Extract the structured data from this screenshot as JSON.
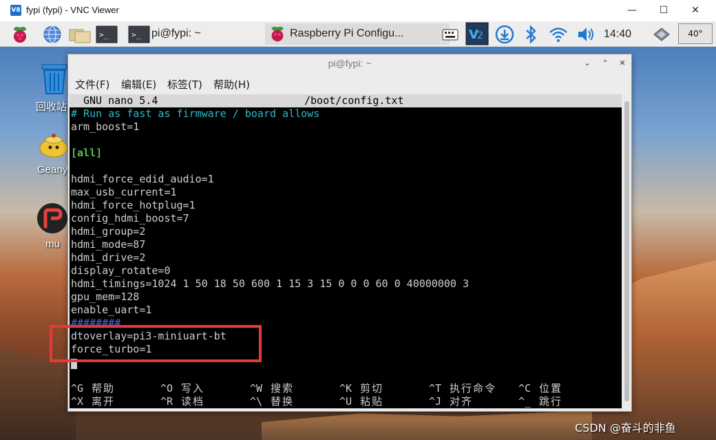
{
  "vnc": {
    "icon_text": "V8",
    "title": "fypi (fypi) - VNC Viewer",
    "minimize": "—",
    "maximize": "☐",
    "close": "✕"
  },
  "taskbar": {
    "tasks": [
      {
        "label": "pi@fypi: ~",
        "icon": "terminal-icon"
      },
      {
        "label": "Raspberry Pi Configu...",
        "icon": "raspberry-icon"
      }
    ],
    "clock": "14:40",
    "cpu_temp": "40°"
  },
  "desktop": {
    "icons": [
      {
        "label": "回收站",
        "icon": "trash-icon"
      },
      {
        "label": "Geany",
        "icon": "geany-icon"
      },
      {
        "label": "mu",
        "icon": "mu-editor-icon"
      }
    ]
  },
  "terminal": {
    "title": "pi@fypi: ~",
    "menu": [
      "文件(F)",
      "编辑(E)",
      "标签(T)",
      "帮助(H)"
    ],
    "header_app": "GNU nano 5.4",
    "header_file": "/boot/config.txt",
    "lines": [
      {
        "text": "# Run as fast as firmware / board allows",
        "style": "cyan"
      },
      {
        "text": "arm_boost=1",
        "style": "plain"
      },
      {
        "text": "",
        "style": "plain"
      },
      {
        "text": "[all]",
        "style": "green"
      },
      {
        "text": "",
        "style": "plain"
      },
      {
        "text": "hdmi_force_edid_audio=1",
        "style": "plain"
      },
      {
        "text": "max_usb_current=1",
        "style": "plain"
      },
      {
        "text": "hdmi_force_hotplug=1",
        "style": "plain"
      },
      {
        "text": "config_hdmi_boost=7",
        "style": "plain"
      },
      {
        "text": "hdmi_group=2",
        "style": "plain"
      },
      {
        "text": "hdmi_mode=87",
        "style": "plain"
      },
      {
        "text": "hdmi_drive=2",
        "style": "plain"
      },
      {
        "text": "display_rotate=0",
        "style": "plain"
      },
      {
        "text": "hdmi_timings=1024 1 50 18 50 600 1 15 3 15 0 0 0 60 0 40000000 3",
        "style": "plain"
      },
      {
        "text": "gpu_mem=128",
        "style": "plain"
      },
      {
        "text": "enable_uart=1",
        "style": "plain"
      },
      {
        "text": "########",
        "style": "blue"
      },
      {
        "text": "dtoverlay=pi3-miniuart-bt",
        "style": "plain"
      },
      {
        "text": "force_turbo=1",
        "style": "plain"
      }
    ],
    "shortcuts_row1": [
      {
        "key": "^G",
        "label": "帮助"
      },
      {
        "key": "^O",
        "label": "写入"
      },
      {
        "key": "^W",
        "label": "搜索"
      },
      {
        "key": "^K",
        "label": "剪切"
      },
      {
        "key": "^T",
        "label": "执行命令"
      },
      {
        "key": "^C",
        "label": "位置"
      }
    ],
    "shortcuts_row2": [
      {
        "key": "^X",
        "label": "离开"
      },
      {
        "key": "^R",
        "label": "读档"
      },
      {
        "key": "^\\",
        "label": "替换"
      },
      {
        "key": "^U",
        "label": "粘贴"
      },
      {
        "key": "^J",
        "label": "对齐"
      },
      {
        "key": "^_",
        "label": "跳行"
      }
    ]
  },
  "watermark": "CSDN @奋斗的非鱼",
  "colors": {
    "highlight_box": "#e63a3a",
    "comment": "#2cb9c5",
    "section": "#4ec94e"
  }
}
